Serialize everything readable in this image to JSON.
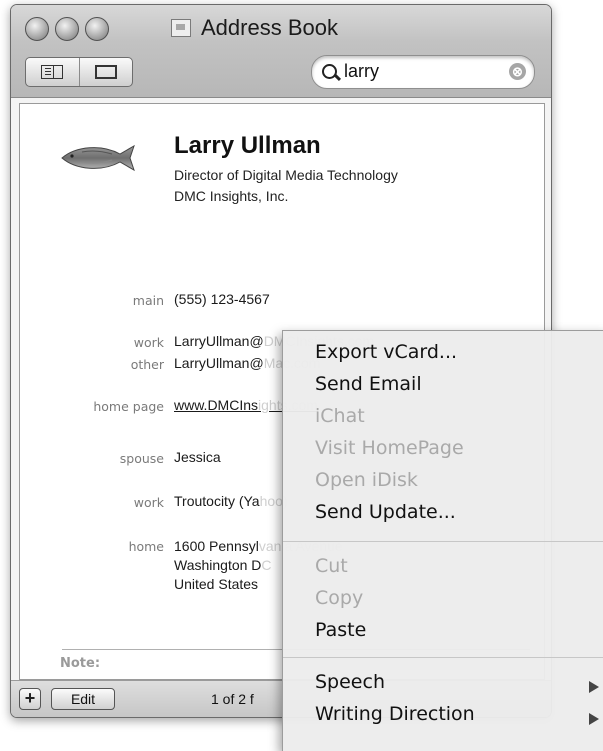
{
  "window": {
    "title": "Address Book"
  },
  "search": {
    "value": "larry",
    "clear_glyph": "⊗"
  },
  "contact": {
    "name": "Larry Ullman",
    "job_title": "Director of Digital Media Technology",
    "company": "DMC Insights, Inc.",
    "fields": {
      "phone_main_label": "main",
      "phone_main_value": "(555) 123-4567",
      "email_work_label": "work",
      "email_work_value": "LarryUllman@",
      "email_work_hidden": "DMCInsights.com",
      "email_other_label": "other",
      "email_other_value": "LarryUllman@",
      "email_other_hidden": "Mac.com",
      "homepage_label": "home page",
      "homepage_value": "www.DMCIns",
      "homepage_hidden": "ights.com",
      "spouse_label": "spouse",
      "spouse_value": "Jessica",
      "aim_label": "work",
      "aim_value": "Troutocity (Ya",
      "aim_hidden": "hoo)",
      "address_label": "home",
      "address_line1": "1600 Pennsyl",
      "address_line1_hidden": "vania Avenue",
      "address_line2": "Washington D",
      "address_line2_hidden": "C",
      "address_line3": "United States",
      "note_label": "Note:"
    }
  },
  "bottombar": {
    "add_label": "+",
    "edit_label": "Edit",
    "count_text": "1 of 2 f"
  },
  "context_menu": {
    "items": [
      {
        "label": "Export vCard...",
        "enabled": true
      },
      {
        "label": "Send Email",
        "enabled": true
      },
      {
        "label": "iChat",
        "enabled": false
      },
      {
        "label": "Visit HomePage",
        "enabled": false
      },
      {
        "label": "Open iDisk",
        "enabled": false
      },
      {
        "label": "Send Update...",
        "enabled": true
      },
      {
        "label": "Cut",
        "enabled": false
      },
      {
        "label": "Copy",
        "enabled": false
      },
      {
        "label": "Paste",
        "enabled": true
      },
      {
        "label": "Speech",
        "enabled": true,
        "submenu": true
      },
      {
        "label": "Writing Direction",
        "enabled": true,
        "submenu": true
      }
    ]
  },
  "icons": {
    "window_controls": [
      "close-icon",
      "minimize-icon",
      "zoom-icon"
    ],
    "view_buttons": [
      "list-view-icon",
      "card-view-icon"
    ],
    "search": "search-icon",
    "photo": "fish-photo-icon"
  }
}
